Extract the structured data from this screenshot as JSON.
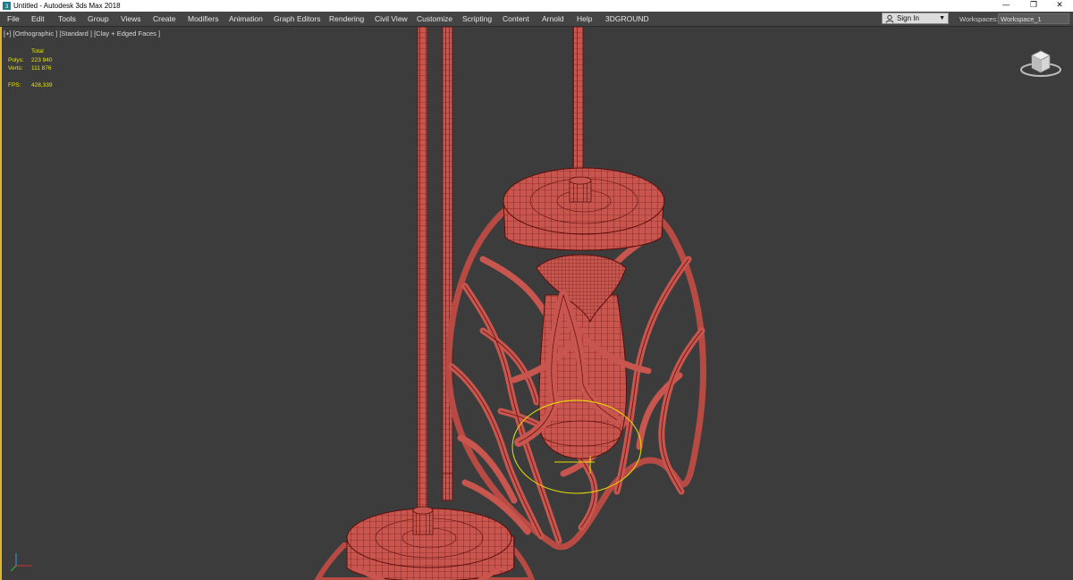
{
  "window": {
    "title": "Untitled - Autodesk 3ds Max 2018",
    "minimize_icon": "—",
    "restore_icon": "❐",
    "close_icon": "✕"
  },
  "menu": {
    "items": [
      "File",
      "Edit",
      "Tools",
      "Group",
      "Views",
      "Create",
      "Modifiers",
      "Animation",
      "Graph Editors",
      "Rendering",
      "Civil View",
      "Customize",
      "Scripting",
      "Content",
      "Arnold",
      "Help",
      "3DGROUND"
    ]
  },
  "signin": {
    "label": "Sign In",
    "caret": "▼"
  },
  "workspace": {
    "label": "Workspaces:",
    "value": "Workspace_1"
  },
  "viewport": {
    "label": "[+] [Orthographic ] [Standard ] [Clay + Edged Faces ]",
    "stats": {
      "header": "Total",
      "polys_label": "Polys:",
      "polys_value": "223 940",
      "verts_label": "Verts:",
      "verts_value": "111 876",
      "fps_label": "FPS:",
      "fps_value": "428,339"
    }
  },
  "colors": {
    "viewport_bg": "#3c3c3c",
    "mesh_fill": "#c9564e",
    "wire": "#5a0e0c",
    "stats_text": "#e8e600",
    "selection": "#e8e000"
  },
  "icons": {
    "app": "3ds-max-icon",
    "user": "user-icon",
    "viewcube": "viewcube-icon",
    "axis": "axis-tripod-icon"
  }
}
